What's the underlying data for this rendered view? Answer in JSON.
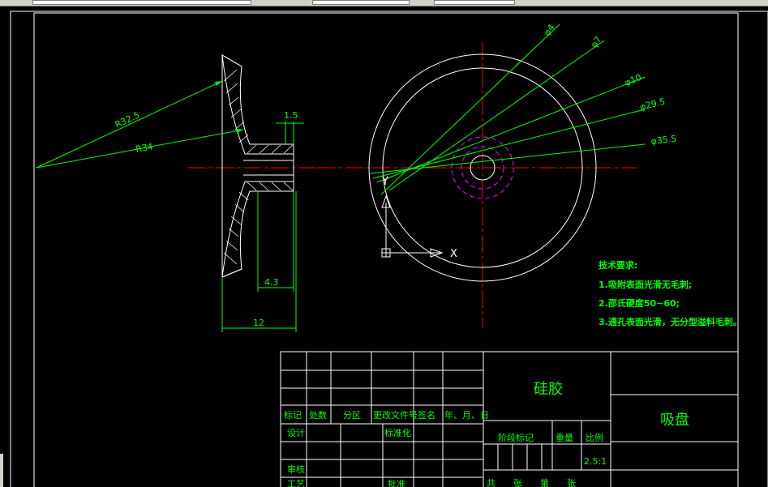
{
  "dims": {
    "r32_5": "R32.5",
    "r34": "R34",
    "d1_5": "1.5",
    "d4_3": "4.3",
    "d12": "12",
    "phi4": "φ4",
    "phi7": "φ7",
    "phi10": "φ10",
    "phi29_5": "φ29.5",
    "phi35_5": "φ35.5"
  },
  "ucs": {
    "x_label": "X",
    "y_label": "Y"
  },
  "notes": {
    "title": "技术要求:",
    "line1": "1.吸附表面光滑无毛刺;",
    "line2": "2.邵氏硬度50~60;",
    "line3": "3.通孔表面光滑，无分型溢料毛刺。"
  },
  "title_block": {
    "material": "硅胶",
    "part_name": "吸盘",
    "h_mark": "标记",
    "h_count": "处数",
    "h_zone": "分区",
    "h_docno": "更改文件号",
    "h_sign": "签名",
    "h_date": "年、月、日",
    "design": "设计",
    "standardize": "标准化",
    "review": "审核",
    "craft": "工艺",
    "approve": "批准",
    "stage_mark": "阶段标记",
    "weight": "重量",
    "scale_label": "比例",
    "scale_value": "2.5:1",
    "sheets": "共　　张　　第　　张"
  },
  "colors": {
    "dimension": "#00ff00",
    "geometry": "#ffffff",
    "centerline": "#ff0000",
    "hidden": "#ff00ff",
    "background": "#000000"
  }
}
